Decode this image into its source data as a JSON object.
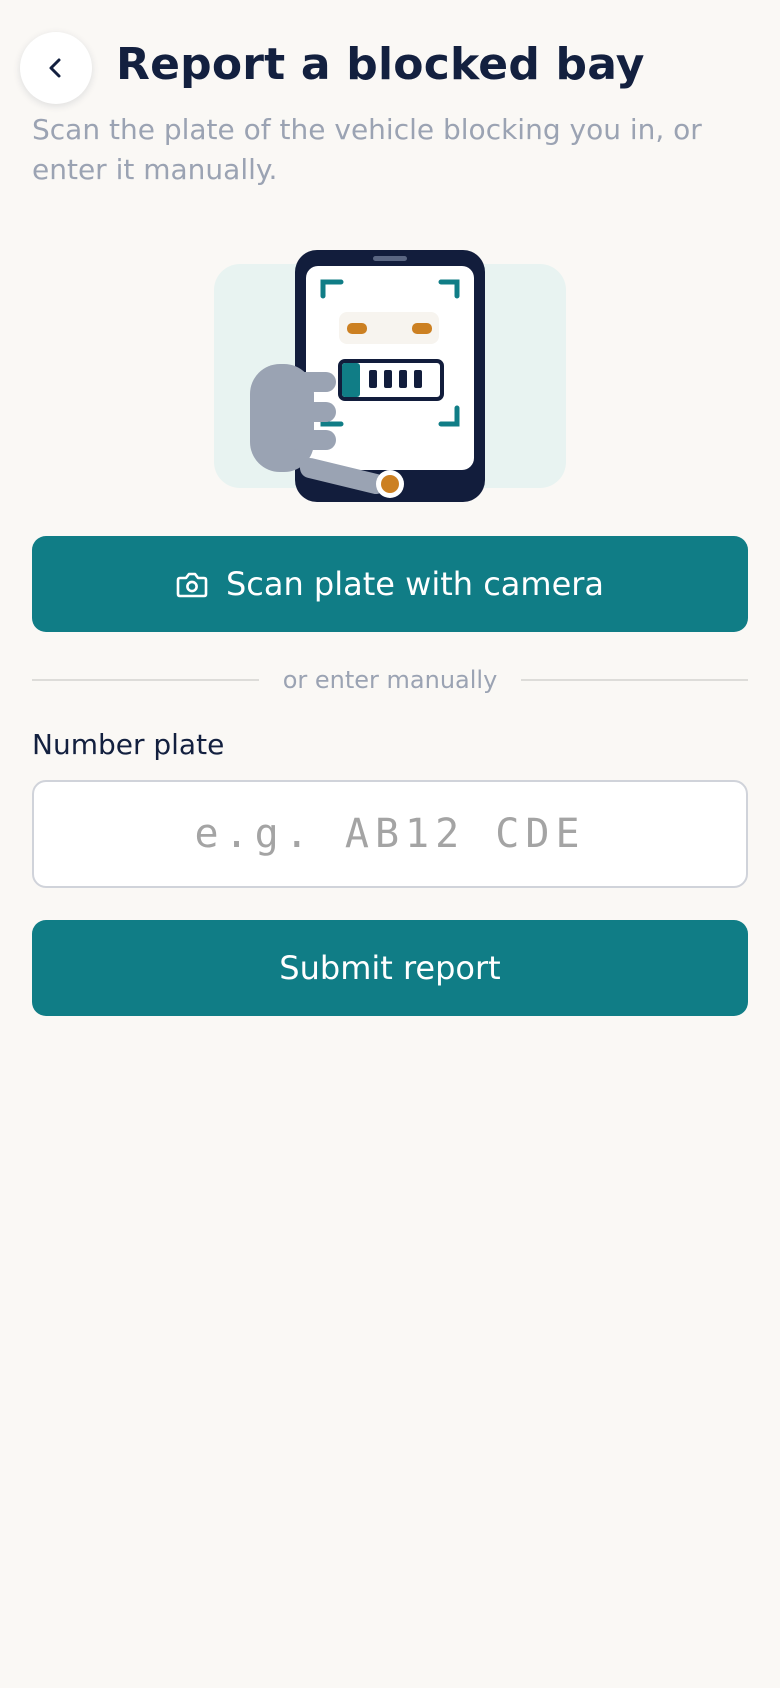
{
  "header": {
    "back_icon": "chevron-left-icon",
    "title": "Report a blocked bay",
    "subtitle": "Scan the plate of the vehicle blocking you in, or enter it manually."
  },
  "illustration": {
    "icon": "phone-scanning-plate-illustration",
    "colors": {
      "phone": "#121d3c",
      "accent": "#107d86",
      "highlight": "#cc8022",
      "hand": "#9aa3b3",
      "backdrop": "#e8f3f1"
    }
  },
  "scan": {
    "icon": "camera-icon",
    "label": "Scan plate with camera"
  },
  "divider": {
    "label": "or enter manually"
  },
  "plate_field": {
    "label": "Number plate",
    "value": "",
    "placeholder": "e.g. AB12 CDE"
  },
  "submit": {
    "label": "Submit report"
  },
  "colors": {
    "primary": "#107d86",
    "heading": "#13203f",
    "muted": "#9ba3b3",
    "background": "#faf8f5"
  }
}
